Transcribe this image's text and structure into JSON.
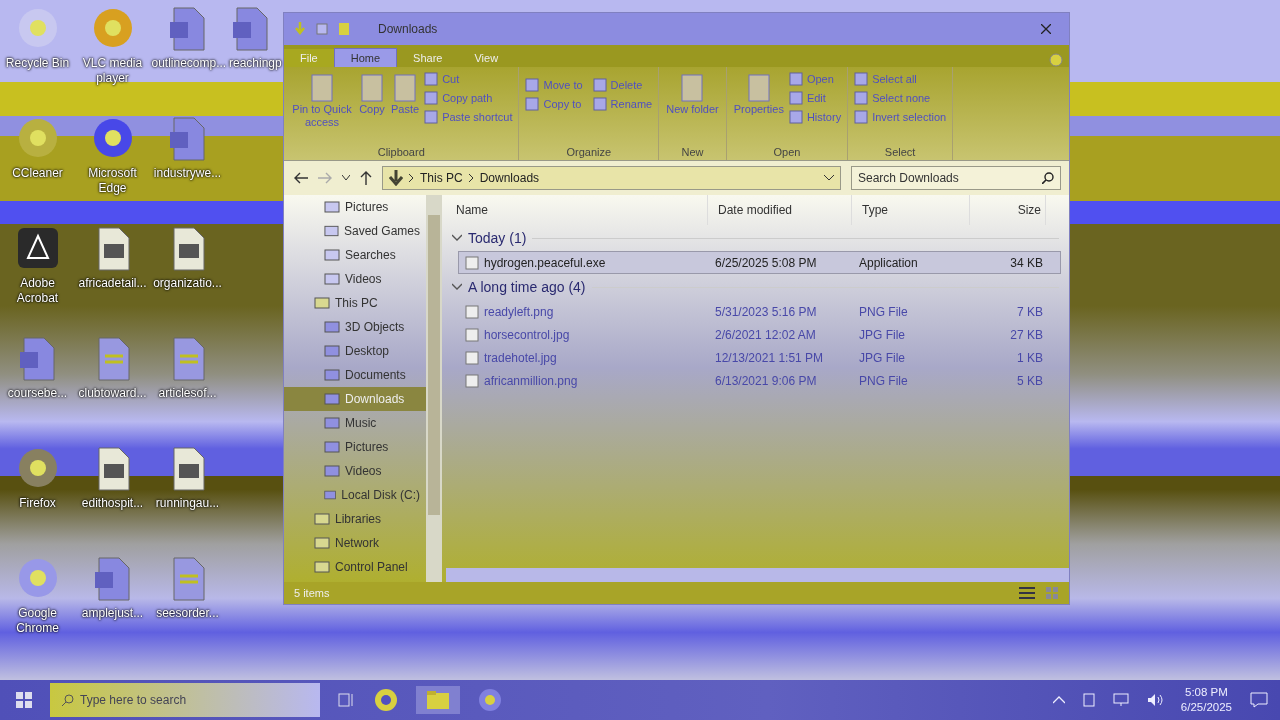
{
  "desktop": {
    "rows": [
      [
        {
          "label": "Recycle Bin",
          "kind": "recycle"
        },
        {
          "label": "VLC media player",
          "kind": "vlc"
        },
        {
          "label": "outlinecomp...",
          "kind": "word"
        },
        {
          "label": "reachingp",
          "kind": "word"
        }
      ],
      [
        {
          "label": "CCleaner",
          "kind": "ccleaner"
        },
        {
          "label": "Microsoft Edge",
          "kind": "edge"
        },
        {
          "label": "industrywe...",
          "kind": "word"
        }
      ],
      [
        {
          "label": "Adobe Acrobat",
          "kind": "acrobat"
        },
        {
          "label": "africadetail...",
          "kind": "image"
        },
        {
          "label": "organizatio...",
          "kind": "image"
        }
      ],
      [
        {
          "label": "coursebe...",
          "kind": "word"
        },
        {
          "label": "clubtoward...",
          "kind": "sheet"
        },
        {
          "label": "articlesof...",
          "kind": "sheet"
        }
      ],
      [
        {
          "label": "Firefox",
          "kind": "firefox"
        },
        {
          "label": "edithospit...",
          "kind": "image"
        },
        {
          "label": "runningau...",
          "kind": "image"
        }
      ],
      [
        {
          "label": "Google Chrome",
          "kind": "chrome"
        },
        {
          "label": "amplejust...",
          "kind": "word"
        },
        {
          "label": "seesorder...",
          "kind": "sheet"
        }
      ]
    ]
  },
  "window": {
    "title": "Downloads",
    "tabs": [
      {
        "label": "File",
        "selected": false
      },
      {
        "label": "Home",
        "selected": true
      },
      {
        "label": "Share",
        "selected": false
      },
      {
        "label": "View",
        "selected": false
      }
    ],
    "ribbon": [
      {
        "name": "Clipboard",
        "large": [
          "Pin to Quick access",
          "Copy",
          "Paste"
        ],
        "small": [
          "Cut",
          "Copy path",
          "Paste shortcut"
        ]
      },
      {
        "name": "Organize",
        "small": [
          "Move to",
          "Copy to",
          "Delete",
          "Rename"
        ]
      },
      {
        "name": "New",
        "large": [
          "New folder"
        ]
      },
      {
        "name": "Open",
        "large": [
          "Properties"
        ],
        "small": [
          "Open",
          "Edit",
          "History"
        ]
      },
      {
        "name": "Select",
        "small": [
          "Select all",
          "Select none",
          "Invert selection"
        ]
      }
    ],
    "path": [
      "This PC",
      "Downloads"
    ],
    "search": {
      "placeholder": "Search Downloads"
    },
    "nav": {
      "continued_children": [
        {
          "label": "Pictures",
          "selected": false
        },
        {
          "label": "Saved Games",
          "selected": false
        },
        {
          "label": "Searches",
          "selected": false
        },
        {
          "label": "Videos",
          "selected": false
        }
      ],
      "items": [
        {
          "label": "This PC",
          "selected": false,
          "children": [
            {
              "label": "3D Objects",
              "selected": false
            },
            {
              "label": "Desktop",
              "selected": false
            },
            {
              "label": "Documents",
              "selected": false
            },
            {
              "label": "Downloads",
              "selected": true
            },
            {
              "label": "Music",
              "selected": false
            },
            {
              "label": "Pictures",
              "selected": false
            },
            {
              "label": "Videos",
              "selected": false
            },
            {
              "label": "Local Disk (C:)",
              "selected": false
            }
          ]
        },
        {
          "label": "Libraries",
          "selected": false
        },
        {
          "label": "Network",
          "selected": false
        },
        {
          "label": "Control Panel",
          "selected": false
        }
      ]
    },
    "columns": [
      "Name",
      "Date modified",
      "Type",
      "Size"
    ],
    "groups": [
      {
        "title": "Today (1)",
        "expanded": true,
        "rows": [
          {
            "name": "hydrogen.peaceful.exe",
            "date": "6/25/2025 5:08 PM",
            "type": "Application",
            "size": "34 KB",
            "selected": true
          }
        ]
      },
      {
        "title": "A long time ago (4)",
        "expanded": true,
        "rows": [
          {
            "name": "readyleft.png",
            "date": "5/31/2023 5:16 PM",
            "type": "PNG File",
            "size": "7 KB",
            "selected": false
          },
          {
            "name": "horsecontrol.jpg",
            "date": "2/6/2021 12:02 AM",
            "type": "JPG File",
            "size": "27 KB",
            "selected": false
          },
          {
            "name": "tradehotel.jpg",
            "date": "12/13/2021 1:51 PM",
            "type": "JPG File",
            "size": "1 KB",
            "selected": false
          },
          {
            "name": "africanmillion.png",
            "date": "6/13/2021 9:06 PM",
            "type": "PNG File",
            "size": "5 KB",
            "selected": false
          }
        ]
      }
    ],
    "status": "5 items"
  },
  "taskbar": {
    "search": {
      "placeholder": "Type here to search"
    },
    "time": "5:08 PM",
    "date": "6/25/2025"
  }
}
